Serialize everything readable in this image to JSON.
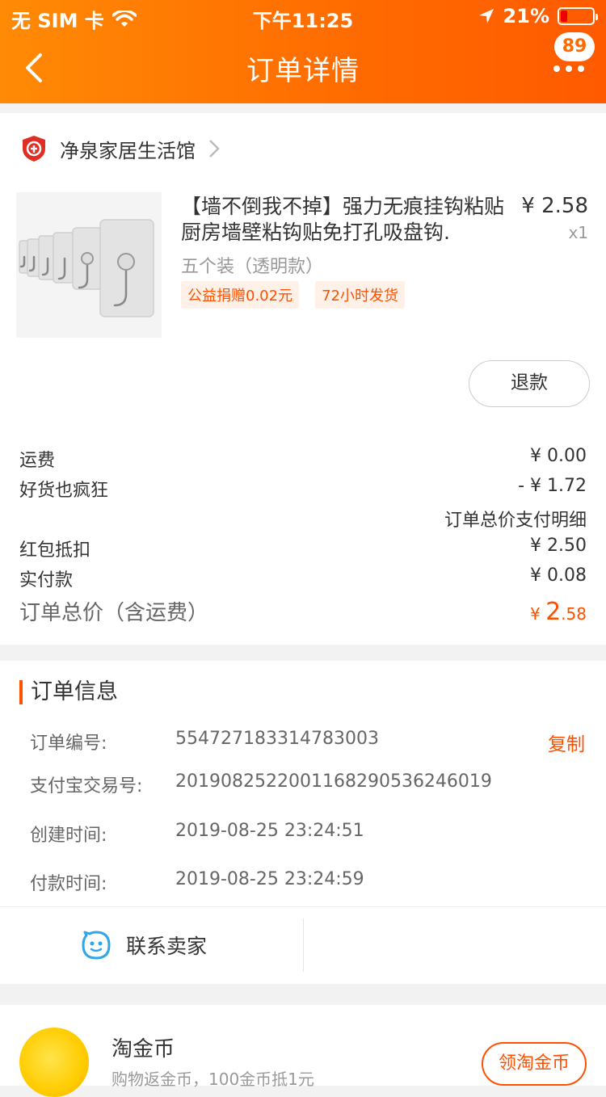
{
  "status": {
    "carrier": "无 SIM 卡",
    "time": "下午11:25",
    "battery": "21%"
  },
  "nav": {
    "title": "订单详情",
    "badge": "89"
  },
  "shop": {
    "name": "净泉家居生活馆"
  },
  "product": {
    "title": "【墙不倒我不掉】强力无痕挂钩粘贴厨房墙壁粘钩贴免打孔吸盘钩.",
    "price": "¥ 2.58",
    "qty": "x1",
    "sku": "五个装（透明款）",
    "tags": [
      "公益捐赠0.02元",
      "72小时发货"
    ],
    "refund": "退款"
  },
  "fees": {
    "shipping_label": "运费",
    "shipping_value": "¥ 0.00",
    "discount_label": "好货也疯狂",
    "discount_value": "- ¥ 1.72",
    "detail_link": "订单总价支付明细",
    "redpack_label": "红包抵扣",
    "redpack_value": "¥ 2.50",
    "paid_label": "实付款",
    "paid_value": "¥ 0.08",
    "total_label": "订单总价（含运费）",
    "total_currency": "¥ ",
    "total_int": "2",
    "total_dec": ".58"
  },
  "order_info": {
    "title": "订单信息",
    "rows": [
      {
        "k": "订单编号:",
        "v": "554727183314783003"
      },
      {
        "k": "支付宝交易号:",
        "v": "2019082522001168290536246019"
      },
      {
        "k": "创建时间:",
        "v": "2019-08-25 23:24:51"
      },
      {
        "k": "付款时间:",
        "v": "2019-08-25 23:24:59"
      }
    ],
    "copy": "复制"
  },
  "contact": {
    "label": "联系卖家"
  },
  "coin": {
    "title": "淘金币",
    "sub": "购物返金币，100金币抵1元",
    "button": "领淘金币"
  },
  "colors": {
    "accent": "#ff5000",
    "nav": "#ff6a00"
  }
}
